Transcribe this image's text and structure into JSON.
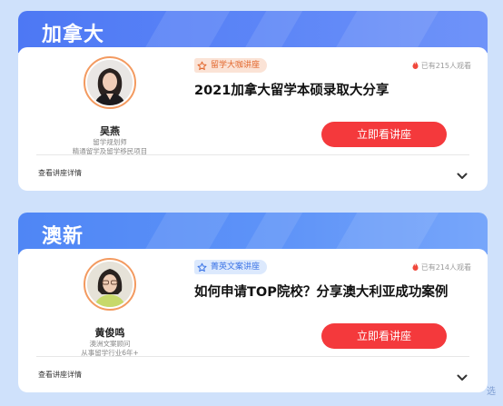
{
  "sections": [
    {
      "title": "加拿大",
      "teacher": {
        "name": "吴燕",
        "line1": "留学规划师",
        "line2": "精通留学及留学移民项目"
      },
      "tag": "留学大咖讲座",
      "views": "已有215人观看",
      "lecture_title": "2021加拿大留学本硕录取大分享",
      "button": "立即看讲座",
      "details": "查看讲座详情"
    },
    {
      "title": "澳新",
      "teacher": {
        "name": "黄俊鸣",
        "line1": "澳洲文案顾问",
        "line2": "从事留学行业6年+"
      },
      "tag": "菁英文案讲座",
      "views": "已有214人观看",
      "lecture_title": "如何申请TOP院校？分享澳大利亚成功案例",
      "button": "立即看讲座",
      "details": "查看讲座详情"
    }
  ],
  "watermark": "选",
  "colors": {
    "page_bg": "#cfe1fb",
    "header": "#4d78f4",
    "button": "#f4393c",
    "tag_orange": "#e2652a",
    "tag_blue": "#3a73e6",
    "flame": "#f0483c"
  },
  "icons": [
    "star-icon",
    "flame-icon",
    "chevron-down-icon"
  ]
}
